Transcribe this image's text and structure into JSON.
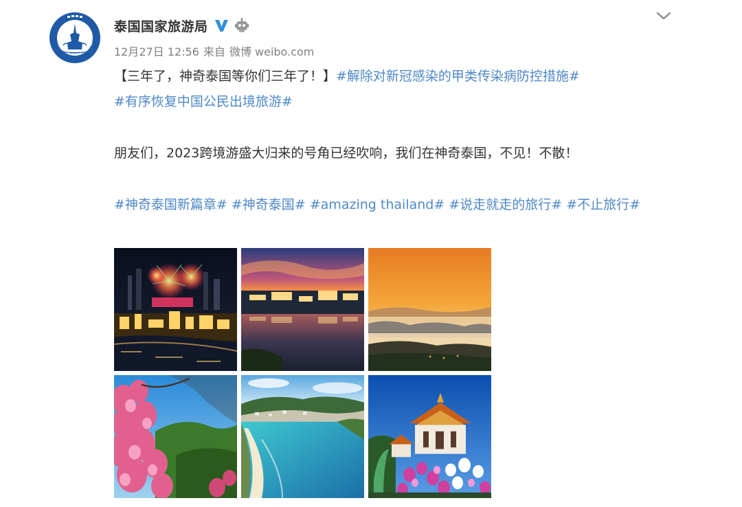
{
  "author": {
    "name": "泰国国家旅游局",
    "verified_icon": "verified-v-icon",
    "robot_icon": "robot-icon",
    "avatar_icon": "tat-logo-icon",
    "avatar_logo_text": "TOURISM AUTHORITY OF THAILAND"
  },
  "meta": {
    "time": "12月27日 12:56",
    "from_label": "来自",
    "source": "微博 weibo.com"
  },
  "post": {
    "headline": "【三年了，神奇泰国等你们三年了！】",
    "topic_1": "#解除对新冠感染的甲类传染病防控措施#",
    "topic_2": "#有序恢复中国公民出境旅游#",
    "body": "朋友们，2023跨境游盛大归来的号角已经吹响，我们在神奇泰国，不见！不散！",
    "tags": [
      "#神奇泰国新篇章#",
      "#神奇泰国#",
      "#amazing thailand#",
      "#说走就走的旅行#",
      "#不止旅行#"
    ]
  },
  "photos": [
    {
      "name": "photo-bangkok-fireworks",
      "desc": "fireworks over Bangkok at night"
    },
    {
      "name": "photo-lake-dusk",
      "desc": "lakeside buildings at dusk"
    },
    {
      "name": "photo-misty-mountains",
      "desc": "misty mountains at sunrise"
    },
    {
      "name": "photo-pink-blossoms",
      "desc": "pink cherry blossoms"
    },
    {
      "name": "photo-beach-bay",
      "desc": "turquoise beach bay"
    },
    {
      "name": "photo-temple",
      "desc": "Thai temple with orchids"
    }
  ],
  "colors": {
    "topic": "#4e88c9",
    "text": "#333333",
    "meta": "#808080",
    "verified": "#2f8fd8"
  },
  "icons": {
    "chevron": "chevron-down-icon"
  }
}
